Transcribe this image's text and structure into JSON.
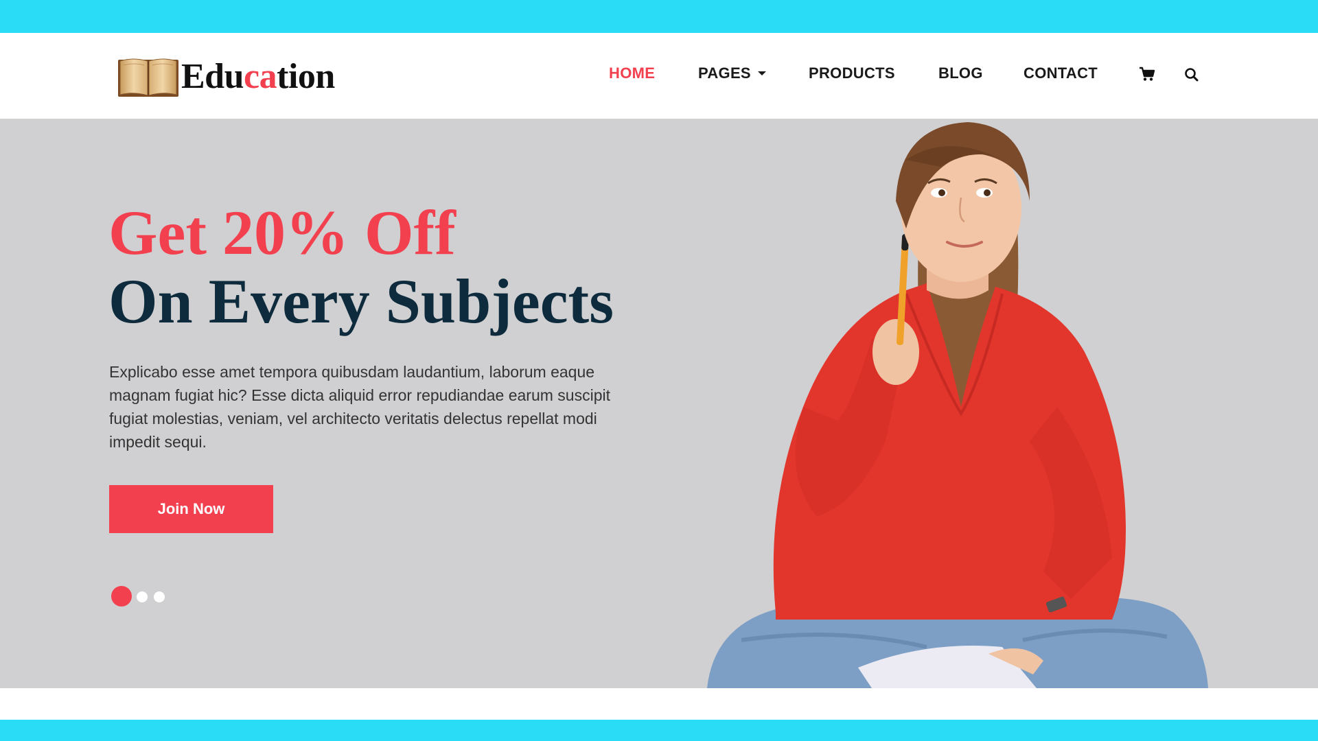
{
  "colors": {
    "accent": "#f2404f",
    "frame": "#2adcf5",
    "heading_dark": "#0d2b3c",
    "hero_bg": "#d0d0d2"
  },
  "logo": {
    "icon": "open-book-icon",
    "text_part1": "Edu",
    "text_accent": "ca",
    "text_part2": "tion"
  },
  "nav": {
    "items": [
      {
        "label": "HOME",
        "active": true
      },
      {
        "label": "PAGES",
        "dropdown": true
      },
      {
        "label": "PRODUCTS"
      },
      {
        "label": "BLOG"
      },
      {
        "label": "CONTACT"
      }
    ],
    "icons": [
      "cart-icon",
      "search-icon"
    ]
  },
  "hero": {
    "headline_line1": "Get 20% Off",
    "headline_line2": "On Every Subjects",
    "description": "Explicabo esse amet tempora quibusdam laudantium, laborum eaque magnam fugiat hic? Esse dicta aliquid error repudiandae earum suscipit fugiat molestias, veniam, vel architecto veritatis delectus repellat modi impedit sequi.",
    "cta_label": "Join Now",
    "slider": {
      "slides": 3,
      "active": 1
    },
    "image": "student-with-pen-photo"
  }
}
